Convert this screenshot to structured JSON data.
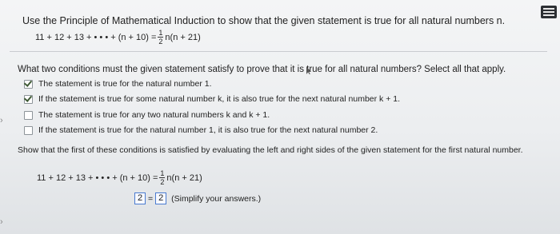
{
  "problem": {
    "intro": "Use the Principle of Mathematical Induction to show that the given statement is true for all natural numbers n.",
    "equation": {
      "left": "11 + 12 + 13 + • • • + (n + 10) =",
      "frac_num": "1",
      "frac_den": "2",
      "right": "n(n + 21)"
    }
  },
  "question": "What two conditions must the given statement satisfy to prove that it is true for all natural numbers? Select all that apply.",
  "options": [
    {
      "label": "The statement is true for the natural number 1.",
      "checked": true
    },
    {
      "label": "If the statement is true for some natural number k, it is also true for the next natural number k + 1.",
      "checked": true
    },
    {
      "label": "The statement is true for any two natural numbers k and k + 1.",
      "checked": false
    },
    {
      "label": "If the statement is true for the natural number 1, it is also true for the next natural number 2.",
      "checked": false
    }
  ],
  "show_prompt": "Show that the first of these conditions is satisfied by evaluating the left and right sides of the given statement for the first natural number.",
  "equation2": {
    "left": "11 + 12 + 13 + • • • + (n + 10) =",
    "frac_num": "1",
    "frac_den": "2",
    "right": "n(n + 21)"
  },
  "answer": {
    "left_value": "2",
    "equals": "=",
    "right_value": "2",
    "hint": "(Simplify your answers.)"
  },
  "icons": {
    "menu": "grid-icon",
    "side_arrow": "›"
  }
}
